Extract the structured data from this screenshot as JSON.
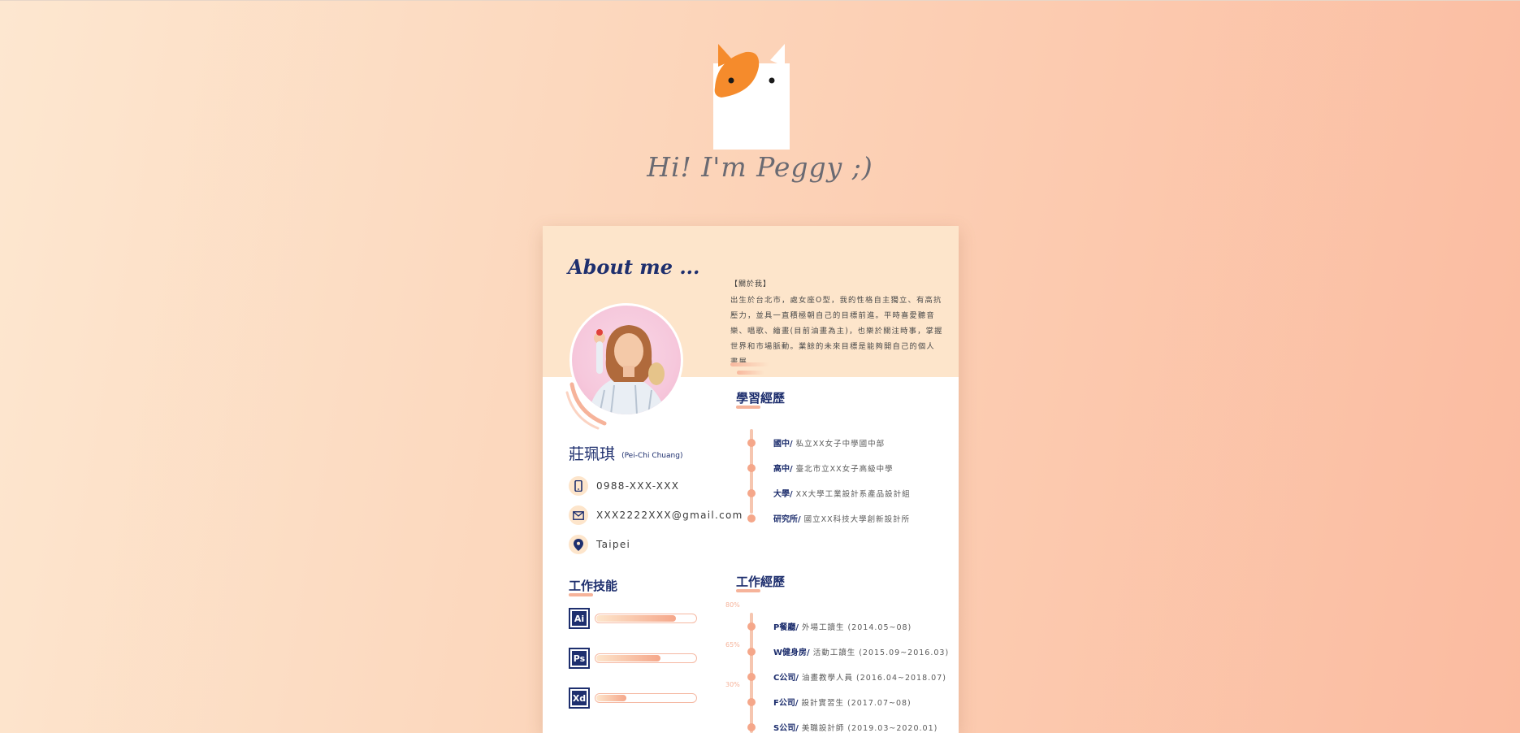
{
  "greeting": "Hi! I'm Peggy ;)",
  "card": {
    "about_title": "About me ...",
    "about_heading": "【關於我】",
    "about_text": "出生於台北市，處女座O型，我的性格自主獨立、有高抗壓力，並具一直積極朝自己的目標前進。平時喜愛聽音樂、唱歌、繪畫(目前油畫為主)，也樂於關注時事，掌握世界和市場脈動。業餘的未來目標是能夠開自己的個人畫展。",
    "name_zh": "莊珮琪",
    "name_en": "(Pei-Chi Chuang)",
    "contacts": [
      {
        "icon": "phone-icon",
        "text": "0988-XXX-XXX"
      },
      {
        "icon": "mail-icon",
        "text": "XXX2222XXX@gmail.com"
      },
      {
        "icon": "location-pin-icon",
        "text": "Taipei"
      }
    ],
    "skills_title": "工作技能",
    "skills": [
      {
        "label": "Ai",
        "percent": 80,
        "percent_text": "80%"
      },
      {
        "label": "Ps",
        "percent": 65,
        "percent_text": "65%"
      },
      {
        "label": "Xd",
        "percent": 30,
        "percent_text": "30%"
      }
    ],
    "education_title": "學習經歷",
    "education": [
      {
        "label": "國中/",
        "value": "私立XX女子中學國中部"
      },
      {
        "label": "高中/",
        "value": "臺北市立XX女子高級中學"
      },
      {
        "label": "大學/",
        "value": "XX大學工業設計系產品設計組"
      },
      {
        "label": "研究所/",
        "value": "國立XX科技大學創新設計所"
      }
    ],
    "work_title": "工作經歷",
    "work": [
      {
        "label": "P餐廳/",
        "value": "外場工讀生 (2014.05~08)"
      },
      {
        "label": "W健身房/",
        "value": "活動工讀生 (2015.09~2016.03)"
      },
      {
        "label": "C公司/",
        "value": "油畫教學人員 (2016.04~2018.07)"
      },
      {
        "label": "F公司/",
        "value": "設計實習生 (2017.07~08)"
      },
      {
        "label": "S公司/",
        "value": "美職設計師 (2019.03~2020.01)"
      }
    ]
  }
}
